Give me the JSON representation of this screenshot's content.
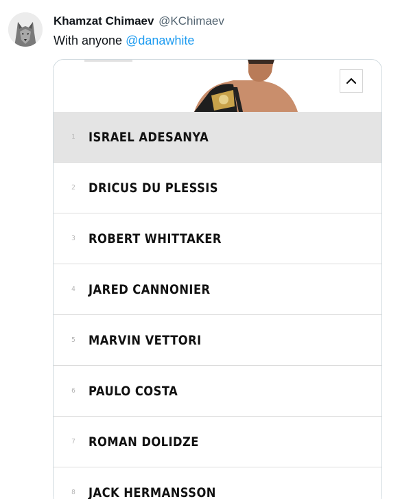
{
  "tweet": {
    "author_name": "Khamzat Chimaev",
    "author_handle": "@KChimaev",
    "text_before": "With anyone ",
    "mention": "@danawhite"
  },
  "icons": {
    "avatar": "wolf-avatar",
    "collapse": "chevron-up-icon"
  },
  "colors": {
    "mention": "#1d9bf0",
    "highlight_row": "#e4e4e4"
  },
  "rankings": [
    {
      "rank": "1",
      "name": "ISRAEL ADESANYA"
    },
    {
      "rank": "2",
      "name": "DRICUS DU PLESSIS"
    },
    {
      "rank": "3",
      "name": "ROBERT WHITTAKER"
    },
    {
      "rank": "4",
      "name": "JARED CANNONIER"
    },
    {
      "rank": "5",
      "name": "MARVIN VETTORI"
    },
    {
      "rank": "6",
      "name": "PAULO COSTA"
    },
    {
      "rank": "7",
      "name": "ROMAN DOLIDZE"
    },
    {
      "rank": "8",
      "name": "JACK HERMANSSON"
    }
  ]
}
